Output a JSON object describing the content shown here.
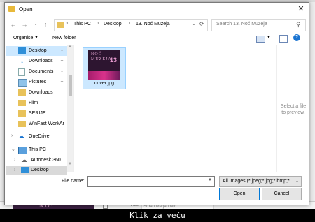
{
  "window": {
    "title": "Open",
    "close_glyph": "✕"
  },
  "nav": {
    "back": "←",
    "forward": "→",
    "recent": "⌄",
    "up": "↑"
  },
  "address": {
    "crumbs": [
      "This PC",
      "Desktop",
      "13. Noć Muzeja"
    ],
    "chevron": "›"
  },
  "search": {
    "placeholder": "Search 13. Noć Muzeja"
  },
  "toolbar": {
    "organise_label": "Organise",
    "new_folder_label": "New folder",
    "help_glyph": "?"
  },
  "sidebar": {
    "items": [
      {
        "label": "Desktop",
        "pinned": true,
        "selected": true
      },
      {
        "label": "Downloads",
        "pinned": true
      },
      {
        "label": "Documents",
        "pinned": true
      },
      {
        "label": "Pictures",
        "pinned": true
      },
      {
        "label": "Downloads"
      },
      {
        "label": "Film"
      },
      {
        "label": "SERIJE"
      },
      {
        "label": "WinFast WorkAr"
      },
      {
        "label": "OneDrive"
      },
      {
        "label": "This PC"
      },
      {
        "label": "Autodesk 360"
      },
      {
        "label": "Desktop",
        "selected": true
      }
    ]
  },
  "files": [
    {
      "name": "cover.jpg",
      "thumb_title": "NOĆ MUZEJA",
      "thumb_number": "13"
    }
  ],
  "preview": {
    "text": "Select a file to preview."
  },
  "bottom": {
    "file_name_label": "File name:",
    "file_name_value": "",
    "filter_value": "All Images (*.jpeg;*.jpg;*.bmp;*",
    "open_label": "Open",
    "cancel_label": "Cancel"
  },
  "background_app": {
    "artist_label": "Artist",
    "artist_value": "Srđan Marjanović",
    "thumb_text": "NOĆ"
  },
  "caption": "Klik za veću",
  "colors": {
    "accent": "#0078d7",
    "selection": "#cce8ff",
    "folder": "#e8c25a"
  }
}
